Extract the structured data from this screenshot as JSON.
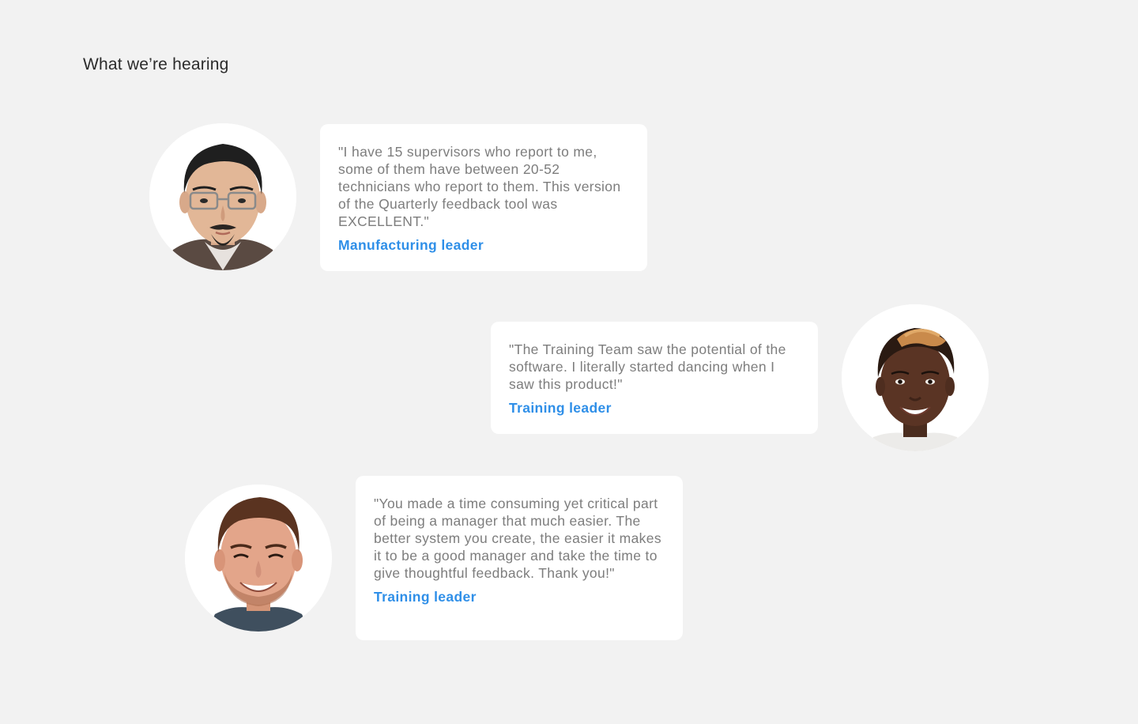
{
  "section": {
    "title": "What we’re hearing"
  },
  "testimonials": [
    {
      "quote": "\"I have 15 supervisors who report to me, some of them have between 20-52 technicians who report to them. This version of the Quarterly feedback tool was EXCELLENT.\"",
      "author": "Manufacturing leader",
      "avatar_icon": "portrait-man-glasses-goatee-icon"
    },
    {
      "quote": "\"The Training Team saw the potential of the software. I literally started dancing when I saw this product!\"",
      "author": "Training leader",
      "avatar_icon": "portrait-woman-short-hair-icon"
    },
    {
      "quote": "\"You made a time consuming yet critical part of being a manager that much easier. The better system you create, the easier it makes it to be a good manager and take the time to give thoughtful feedback. Thank you!\"",
      "author": "Training leader",
      "avatar_icon": "portrait-man-beard-smiling-icon"
    }
  ],
  "colors": {
    "background": "#f2f2f2",
    "card": "#ffffff",
    "quote_text": "#7d7d7d",
    "author_accent": "#2f8fe8",
    "title_text": "#2b2b2b"
  }
}
